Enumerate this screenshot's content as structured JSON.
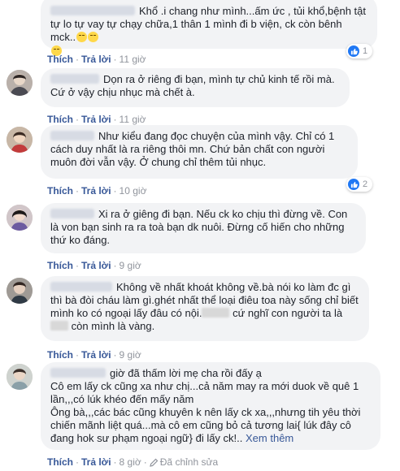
{
  "labels": {
    "like": "Thích",
    "reply": "Trả lời",
    "dot": "·",
    "edit": "Đã chỉnh sửa",
    "see_more": "Xem thêm"
  },
  "colors": {
    "link": "#385898",
    "bubble": "#f2f3f5",
    "like_blue": "#2078f4"
  },
  "comments": [
    {
      "text": "Khổ .i chang như mình...ấm ức , tủi khổ,bệnh tật tự lo tự vay tự chạy chữa,1 thân 1 mình đi b viện, ck còn bênh mck..",
      "emojis": [
        "pensive-emoji",
        "relieved-emoji",
        "relieved-emoji"
      ],
      "time": "11 giờ",
      "reaction_count": "1"
    },
    {
      "text": "Dọn ra ở riêng đi bạn, mình tự chủ kinh tế rồi mà. Cứ ở vậy chịu nhục mà chết à.",
      "time": "11 giờ"
    },
    {
      "text": "Như kiểu đang đọc chuyện của mình vậy. Chỉ có 1 cách duy nhất là ra riêng thôi mn. Chứ bản chất con người muôn đời vẫn vậy. Ở chung chỉ thêm tủi nhục.",
      "time": "10 giờ",
      "reaction_count": "2"
    },
    {
      "text": "Xi ra ở giêng đi bạn. Nếu ck ko chịu thì đừng về. Con là von bạn sinh ra ra toà bạn dk nuôi. Đừng cố hiến cho những thứ ko đáng.",
      "time": "9 giờ"
    },
    {
      "text_a": "Không về nhất khoát không về.bà nói ko làm đc gì thì bà đòi cháu làm gì.ghét nhất thể loại điêu toa này sống chỉ biết mình ko có ngoại lấy đâu có nội.",
      "text_b": "cứ nghĩ con người ta là",
      "text_c": "còn mình là vàng.",
      "time": "9 giờ"
    },
    {
      "line1": "giờ đã thấm lời mẹ cha rồi đấy ạ",
      "line2": "Cô em lấy ck cũng xa như chị...cả năm may ra mới duok về quê 1 lần,,,có lúk khéo đến mấy năm",
      "line3": "Ông bà,,,các bác cũng khuyên k nên lấy ck xa,,,nhưng tih yêu thời chiến mãnh liệt quá...mà cô em cũng bỏ cả tương lai{ lúk đây cô đang hok sư phạm ngoại ngữ} đi lấy ck!..",
      "time": "8 giờ"
    }
  ]
}
